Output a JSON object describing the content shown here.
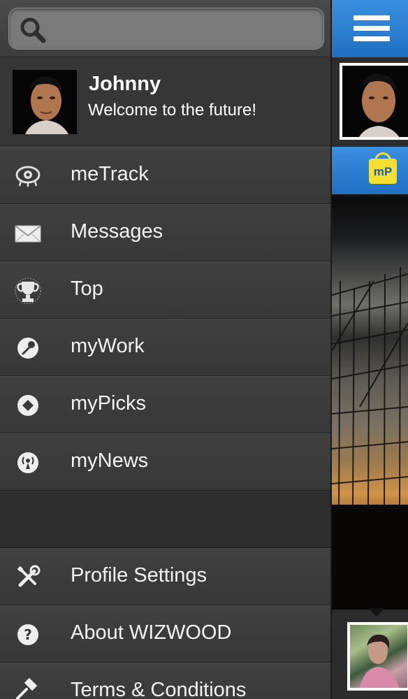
{
  "search": {
    "placeholder": ""
  },
  "profile": {
    "name": "Johnny",
    "tagline": "Welcome to the future!"
  },
  "menu": {
    "items": [
      {
        "label": "meTrack",
        "icon": "eye-tracking-icon"
      },
      {
        "label": "Messages",
        "icon": "envelope-icon"
      },
      {
        "label": "Top",
        "icon": "trophy-icon"
      },
      {
        "label": "myWork",
        "icon": "work-circle-icon"
      },
      {
        "label": "myPicks",
        "icon": "picks-circle-icon"
      },
      {
        "label": "myNews",
        "icon": "news-broadcast-icon"
      }
    ],
    "bottom_items": [
      {
        "label": "Profile Settings",
        "icon": "wrench-screwdriver-icon"
      },
      {
        "label": "About WIZWOOD",
        "icon": "question-circle-icon"
      },
      {
        "label": "Terms & Conditions",
        "icon": "gavel-icon"
      }
    ]
  },
  "right_panel": {
    "badge_text": "mP"
  },
  "colors": {
    "drawer_bg": "#3a3a3a",
    "accent_blue": "#2a7fd4",
    "badge_yellow": "#f3e033",
    "text": "#f2f2f2"
  }
}
